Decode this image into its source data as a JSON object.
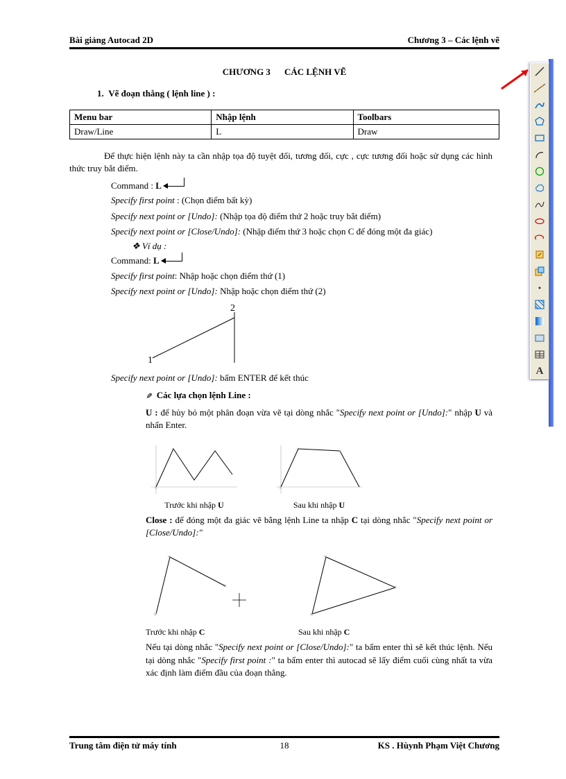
{
  "header": {
    "left": "Bài giảng Autocad  2D",
    "right": "Chương 3 –   Các lệnh vẽ"
  },
  "chapter": {
    "num": "CHƯƠNG 3",
    "title": "CÁC LỆNH VẼ"
  },
  "section1": {
    "num": "1.",
    "title": "Vẽ đoạn thẳng  ( lệnh line ) :"
  },
  "table": {
    "headers": [
      "Menu bar",
      "Nhập lệnh",
      "Toolbars"
    ],
    "row": [
      "Draw/Line",
      "L",
      "Draw"
    ]
  },
  "text": {
    "p1": "Để thực hiện lệnh này ta cần nhập tọa độ tuyệt đối, tương đối, cực , cực tương đối hoặc sử dụng các hình thức truy bắt điểm.",
    "cmd1": "Command : ",
    "cmd1b": "L",
    "s1": "Specify first point",
    "s1t": " : (Chọn điểm bất kỳ)",
    "s2": "Specify next point or [Undo]:",
    "s2t": " (Nhập tọa độ điểm thứ 2 hoặc truy bắt điểm)",
    "s3": "Specify next point or [Close/Undo]:",
    "s3t": " (Nhập điểm thứ 3 hoặc chọn C để đóng một đa giác)",
    "vd": "❖   Ví dụ  :",
    "cmd2": "Command:  ",
    "cmd2b": "L",
    "sf1": "Specify first point",
    "sf1t": ":  Nhập hoặc chọn điểm thứ (1)",
    "sf2": "Specify next point or [Undo]:",
    "sf2t": "  Nhập hoặc chọn điểm thứ (2)",
    "se": "Specify next point or [Undo]:",
    "set": "  bấm ENTER  để kết thúc",
    "opt_hdr": "Các lựa chọn lệnh Line :",
    "u_b": "U : ",
    "u_t1": "để hủy bỏ một phân đoạn vừa vẽ tại dòng nhắc \"",
    "u_i": "Specify next point or [Undo]:",
    "u_t2": "\" nhập ",
    "u_b2": "U",
    "u_t3": " và nhấn Enter.",
    "cap_before_u": "Trước khi nhập ",
    "cap_after_u": "Sau khi nhập ",
    "close_b": "Close : ",
    "close_t1": "để đóng một đa giác vẽ bằng lệnh Line ta nhập ",
    "close_b2": "C",
    "close_t2": " tại dòng nhắc \"",
    "close_i": "Specify next point or [Close/Undo]:\"",
    "cap_before_c": "Trước khi nhập ",
    "cap_after_c": "Sau khi nhập ",
    "note1a": "Nếu tại dòng nhắc \"",
    "note1i": "Specify next point or [Close/Undo]:",
    "note1b": "\" ta bấm enter thì sẽ kết thúc lệnh. Nếu tại dòng nhắc \"",
    "note2i": "Specify first point :",
    "note2b": "\" ta bấm enter thì autocad sẽ lấy điểm cuối cùng nhất ta vừa xác định làm điểm đầu của đoạn thẳng."
  },
  "figure12": {
    "label1": "1",
    "label2": "2"
  },
  "footer": {
    "left": "Trung tâm điện tử máy tính",
    "page": "18",
    "right": "KS . Hùynh Phạm Việt Chương"
  },
  "toolbar_icons": [
    "line",
    "construction",
    "polyline",
    "polygon",
    "rectangle",
    "arc",
    "circle",
    "revcloud",
    "spline",
    "ellipse",
    "ellipse-arc",
    "block",
    "point1",
    "point2",
    "hatch",
    "gradient",
    "region",
    "table",
    "text"
  ]
}
